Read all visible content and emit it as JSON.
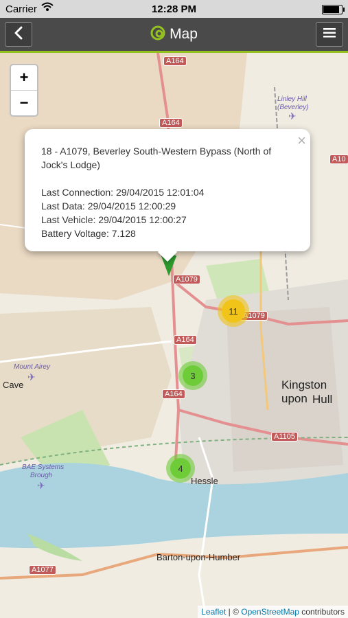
{
  "status_bar": {
    "carrier": "Carrier",
    "time": "12:28 PM",
    "battery_level_percent": 95
  },
  "nav_bar": {
    "title": "Map",
    "back_icon": "chevron-left-icon",
    "menu_icon": "hamburger-menu-icon",
    "logo_icon": "app-logo-icon"
  },
  "map": {
    "zoom_in_label": "+",
    "zoom_out_label": "−",
    "popup": {
      "title": "18 - A1079, Beverley South-Western Bypass (North of Jock's Lodge)",
      "last_connection": "Last Connection: 29/04/2015 12:01:04",
      "last_data": "Last Data: 29/04/2015 12:00:29",
      "last_vehicle": "Last Vehicle: 29/04/2015 12:00:27",
      "battery_voltage": "Battery Voltage: 7.128",
      "close_label": "×"
    },
    "clusters": [
      {
        "count": "11",
        "color": "#f0c419"
      },
      {
        "count": "3",
        "color": "#6ecc39"
      },
      {
        "count": "4",
        "color": "#6ecc39"
      }
    ],
    "place_labels": {
      "kingston": "Kingston upon",
      "hull": "Hull",
      "hessle": "Hessle",
      "cave": "Cave",
      "barton": "Barton-upon-Humber",
      "mount_airey": "Mount Airey",
      "linley_hill": "Linley Hill",
      "beverley": "(Beverley)",
      "bae": "BAE Systems",
      "brough": "Brough"
    },
    "road_labels": {
      "a164_top": "A164",
      "a164_2": "A164",
      "a164_mid": "A164",
      "a164_low": "A164",
      "a1079_a": "A1079",
      "a1079_b": "A1079",
      "a1105": "A1105",
      "a1077": "A1077",
      "a10_edge": "A10"
    },
    "attribution": {
      "leaflet": "Leaflet",
      "separator": " | © ",
      "osm": "OpenStreetMap",
      "contributors": " contributors"
    }
  },
  "colors": {
    "nav_background": "#4a4a4a",
    "accent_green": "#94c11f",
    "marker_green": "#2e9a2e",
    "water": "#aad3df"
  }
}
